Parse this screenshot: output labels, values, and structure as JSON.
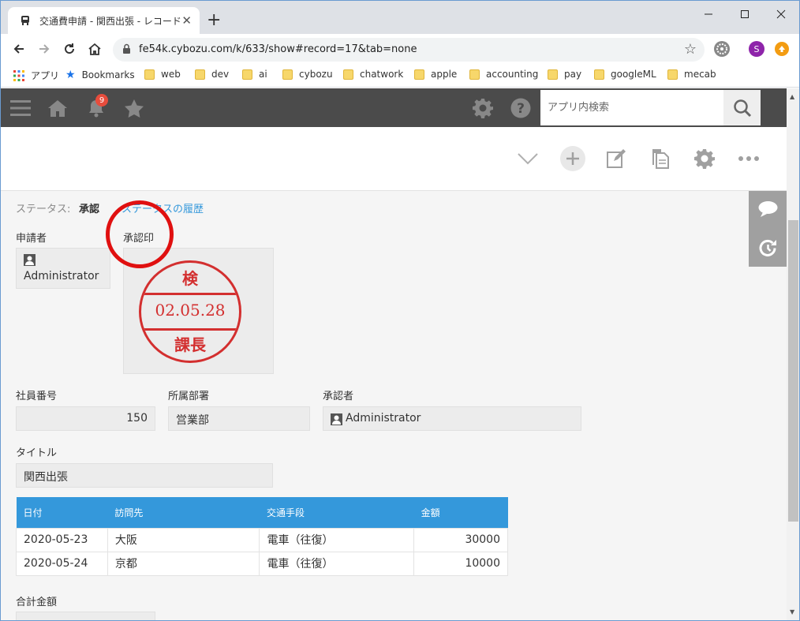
{
  "browser": {
    "tab_title": "交通費申請 - 関西出張 - レコードの",
    "url": "fe54k.cybozu.com/k/633/show#record=17&tab=none",
    "profile_initial": "S",
    "bookmarks": [
      "アプリ",
      "Bookmarks",
      "web",
      "dev",
      "ai",
      "cybozu",
      "chatwork",
      "apple",
      "accounting",
      "pay",
      "googleML",
      "mecab"
    ]
  },
  "header": {
    "notification_count": "9",
    "search_placeholder": "アプリ内検索"
  },
  "record": {
    "status_label": "ステータス:",
    "status_value": "承認",
    "status_history": "ステータスの履歴",
    "applicant_label": "申請者",
    "applicant_value": "Administrator",
    "stamp_label": "承認印",
    "stamp": {
      "top": "検",
      "date": "02.05.28",
      "bottom": "課長"
    },
    "employee_no_label": "社員番号",
    "employee_no_value": "150",
    "department_label": "所属部署",
    "department_value": "営業部",
    "approver_label": "承認者",
    "approver_value": "Administrator",
    "title_label": "タイトル",
    "title_value": "関西出張",
    "table": {
      "headers": [
        "日付",
        "訪問先",
        "交通手段",
        "金額"
      ],
      "rows": [
        [
          "2020-05-23",
          "大阪",
          "電車（往復）",
          "30000"
        ],
        [
          "2020-05-24",
          "京都",
          "電車（往復）",
          "10000"
        ]
      ]
    },
    "total_label": "合計金額"
  },
  "colors": {
    "accent": "#3498db",
    "header_bg": "#4b4b4b",
    "stamp_red": "#d32f2f",
    "annotation_red": "#e01010"
  }
}
